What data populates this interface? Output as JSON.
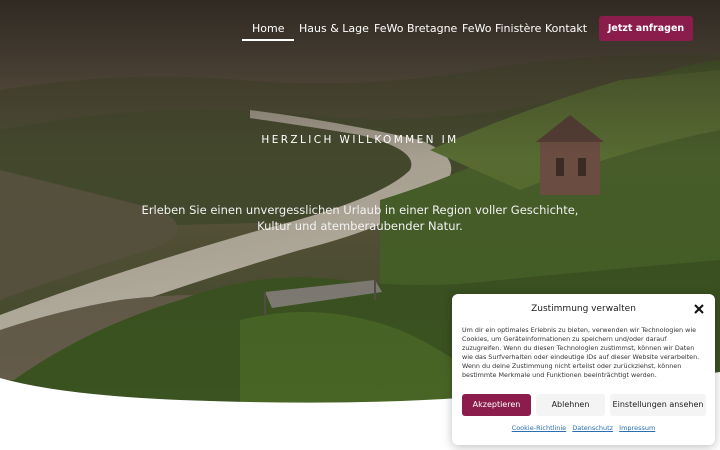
{
  "nav": {
    "items": [
      {
        "label": "Home",
        "active": true
      },
      {
        "label": "Haus & Lage",
        "active": false
      },
      {
        "label": "FeWo Bretagne",
        "active": false
      },
      {
        "label": "FeWo Finistère",
        "active": false
      },
      {
        "label": "Kontakt",
        "active": false
      }
    ],
    "cta_label": "Jetzt anfragen"
  },
  "hero": {
    "welcome": "HERZLICH WILLKOMMEN IM",
    "tagline": "Erleben Sie einen unvergesslichen Urlaub in einer Region voller Geschichte, Kultur und atemberaubender Natur."
  },
  "cookie": {
    "title": "Zustimmung verwalten",
    "text": "Um dir ein optimales Erlebnis zu bieten, verwenden wir Technologien wie Cookies, um Geräteinformationen zu speichern und/oder darauf zuzugreifen. Wenn du diesen Technologien zustimmst, können wir Daten wie das Surfverhalten oder eindeutige IDs auf dieser Website verarbeiten. Wenn du deine Zustimmung nicht erteilst oder zurückziehst, können bestimmte Merkmale und Funktionen beeinträchtigt werden.",
    "accept_label": "Akzeptieren",
    "deny_label": "Ablehnen",
    "settings_label": "Einstellungen ansehen",
    "links": [
      "Cookie-Richtlinie",
      "Datenschutz",
      "Impressum"
    ]
  },
  "colors": {
    "accent": "#8a1d4c",
    "link": "#2a6fb0"
  }
}
